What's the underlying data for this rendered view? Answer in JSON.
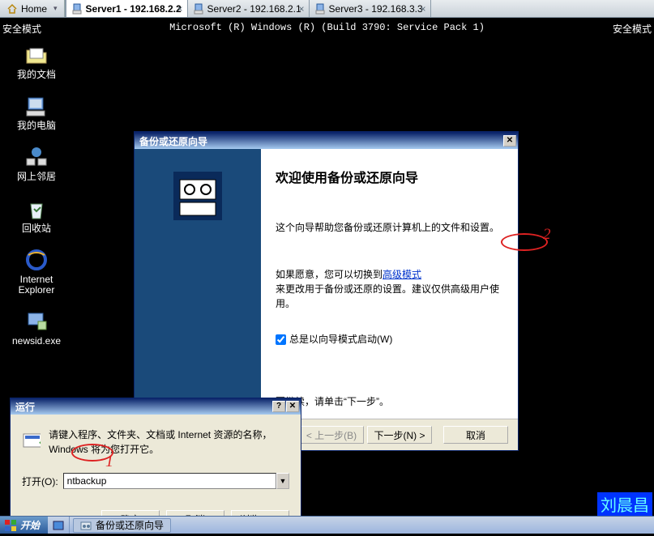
{
  "tabs": {
    "home": "Home",
    "tab1": "Server1 - 192.168.2.2",
    "tab2": "Server2 - 192.168.2.1",
    "tab3": "Server3 - 192.168.3.3"
  },
  "desktop": {
    "safe_mode": "安全模式",
    "ms_line": "Microsoft (R) Windows (R) (Build 3790: Service Pack 1)",
    "icons": {
      "mydocs": "我的文档",
      "mycomputer": "我的电脑",
      "network": "网上邻居",
      "recycle": "回收站",
      "ie": "Internet\nExplorer",
      "newsid": "newsid.exe"
    }
  },
  "wizard": {
    "title": "备份或还原向导",
    "heading": "欢迎使用备份或还原向导",
    "p1": "这个向导帮助您备份或还原计算机上的文件和设置。",
    "p2a": "如果愿意，您可以切换到",
    "advlink": "高级模式",
    "p2b": "来更改用于备份或还原的设置。建议仅供高级用户使用。",
    "checkbox": "总是以向导模式启动(W)",
    "continue": "要继续，请单击“下一步”。",
    "back": "< 上一步(B)",
    "next": "下一步(N) >",
    "cancel": "取消"
  },
  "run": {
    "title": "运行",
    "desc": "请键入程序、文件夹、文档或 Internet 资源的名称，Windows 将为您打开它。",
    "open_label": "打开(O):",
    "value": "ntbackup",
    "ok": "确定",
    "cancel": "取消",
    "browse": "浏览(B)..."
  },
  "taskbar": {
    "start": "开始",
    "task1": "备份或还原向导"
  },
  "author": "刘晨昌"
}
